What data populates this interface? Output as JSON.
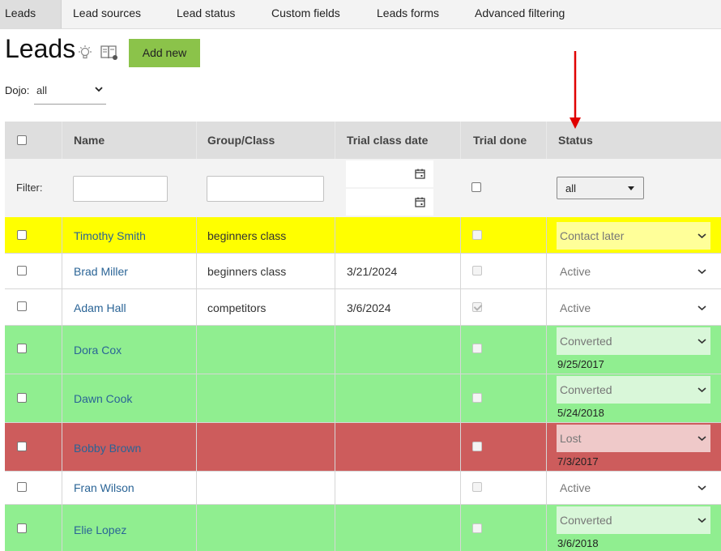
{
  "tabs": [
    {
      "label": "Leads",
      "active": true
    },
    {
      "label": "Lead sources",
      "active": false
    },
    {
      "label": "Lead status",
      "active": false
    },
    {
      "label": "Custom fields",
      "active": false
    },
    {
      "label": "Leads forms",
      "active": false
    },
    {
      "label": "Advanced filtering",
      "active": false
    }
  ],
  "header": {
    "title": "Leads",
    "add_button": "Add new",
    "icons": [
      "lightbulb-icon",
      "book-icon"
    ]
  },
  "dojo": {
    "label": "Dojo:",
    "value": "all"
  },
  "table": {
    "columns": [
      "Name",
      "Group/Class",
      "Trial class date",
      "Trial done",
      "Status"
    ],
    "filter_label": "Filter:",
    "status_filter": "all",
    "rows": [
      {
        "name": "Timothy Smith",
        "group": "beginners class",
        "trial_date": "",
        "trial_done": false,
        "status": "Contact later",
        "status_date": ""
      },
      {
        "name": "Brad Miller",
        "group": "beginners class",
        "trial_date": "3/21/2024",
        "trial_done": false,
        "status": "Active",
        "status_date": ""
      },
      {
        "name": "Adam Hall",
        "group": "competitors",
        "trial_date": "3/6/2024",
        "trial_done": true,
        "status": "Active",
        "status_date": ""
      },
      {
        "name": "Dora Cox",
        "group": "",
        "trial_date": "",
        "trial_done": false,
        "status": "Converted",
        "status_date": "9/25/2017"
      },
      {
        "name": "Dawn Cook",
        "group": "",
        "trial_date": "",
        "trial_done": false,
        "status": "Converted",
        "status_date": "5/24/2018"
      },
      {
        "name": "Bobby Brown",
        "group": "",
        "trial_date": "",
        "trial_done": false,
        "status": "Lost",
        "status_date": "7/3/2017"
      },
      {
        "name": "Fran Wilson",
        "group": "",
        "trial_date": "",
        "trial_done": false,
        "status": "Active",
        "status_date": ""
      },
      {
        "name": "Elie Lopez",
        "group": "",
        "trial_date": "",
        "trial_done": false,
        "status": "Converted",
        "status_date": "3/6/2018"
      }
    ]
  },
  "colors": {
    "contact_later": "#ffff00",
    "converted": "#90ee90",
    "lost": "#cd5c5c",
    "add_button": "#8bc34a",
    "annotation_arrow": "#e00000"
  }
}
